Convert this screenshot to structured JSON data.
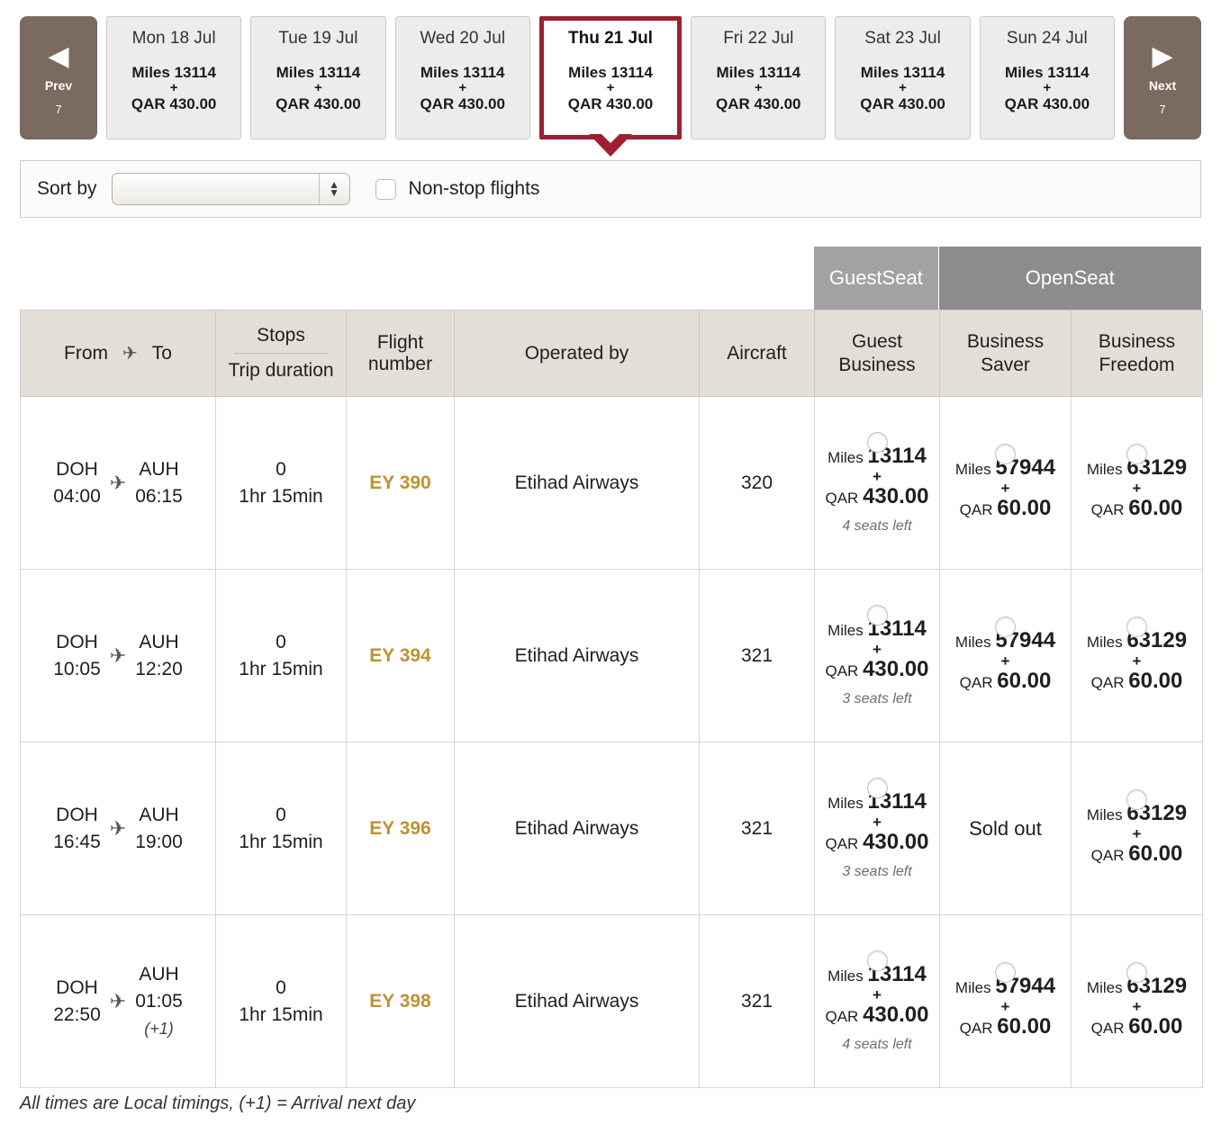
{
  "date_strip": {
    "prev": {
      "label": "Prev",
      "count": "7",
      "icon": "chevron-left-icon",
      "glyph": "◀"
    },
    "next": {
      "label": "Next",
      "count": "7",
      "icon": "chevron-right-icon",
      "glyph": "▶"
    },
    "miles_prefix": "Miles",
    "plus": "+",
    "currency": "QAR",
    "cards": [
      {
        "date": "Mon 18 Jul",
        "miles": "13114",
        "amount": "430.00",
        "selected": false
      },
      {
        "date": "Tue 19 Jul",
        "miles": "13114",
        "amount": "430.00",
        "selected": false
      },
      {
        "date": "Wed 20 Jul",
        "miles": "13114",
        "amount": "430.00",
        "selected": false
      },
      {
        "date": "Thu 21 Jul",
        "miles": "13114",
        "amount": "430.00",
        "selected": true
      },
      {
        "date": "Fri 22 Jul",
        "miles": "13114",
        "amount": "430.00",
        "selected": false
      },
      {
        "date": "Sat 23 Jul",
        "miles": "13114",
        "amount": "430.00",
        "selected": false
      },
      {
        "date": "Sun 24 Jul",
        "miles": "13114",
        "amount": "430.00",
        "selected": false
      }
    ]
  },
  "sort_bar": {
    "sort_label": "Sort by",
    "sort_value": "",
    "spinner_up": "▲",
    "spinner_down": "▼",
    "nonstop_label": "Non-stop flights",
    "nonstop_checked": false
  },
  "table": {
    "group_headers": [
      {
        "label": "GuestSeat",
        "span": 1
      },
      {
        "label": "OpenSeat",
        "span": 2
      }
    ],
    "columns": {
      "from": "From",
      "to": "To",
      "plane_icon": "airplane-icon",
      "stops": "Stops",
      "trip_duration": "Trip duration",
      "flight_number": "Flight number",
      "operated_by": "Operated by",
      "aircraft": "Aircraft"
    },
    "fare_columns": [
      {
        "label": "Guest Business",
        "line1": "Guest",
        "line2": "Business"
      },
      {
        "label": "Business Saver",
        "line1": "Business",
        "line2": "Saver"
      },
      {
        "label": "Business Freedom",
        "line1": "Business",
        "line2": "Freedom"
      }
    ],
    "miles_prefix": "Miles",
    "plus": "+",
    "currency": "QAR",
    "sold_out_text": "Sold out",
    "rows": [
      {
        "from_code": "DOH",
        "from_time": "04:00",
        "to_code": "AUH",
        "to_time": "06:15",
        "to_nextday": "",
        "stops": "0",
        "duration": "1hr 15min",
        "flight_number": "EY 390",
        "operated_by": "Etihad Airways",
        "aircraft": "320",
        "fares": [
          {
            "available": true,
            "miles": "13114",
            "amount": "430.00",
            "seats_left": "4 seats left"
          },
          {
            "available": true,
            "miles": "57944",
            "amount": "60.00",
            "seats_left": ""
          },
          {
            "available": true,
            "miles": "63129",
            "amount": "60.00",
            "seats_left": ""
          }
        ]
      },
      {
        "from_code": "DOH",
        "from_time": "10:05",
        "to_code": "AUH",
        "to_time": "12:20",
        "to_nextday": "",
        "stops": "0",
        "duration": "1hr 15min",
        "flight_number": "EY 394",
        "operated_by": "Etihad Airways",
        "aircraft": "321",
        "fares": [
          {
            "available": true,
            "miles": "13114",
            "amount": "430.00",
            "seats_left": "3 seats left"
          },
          {
            "available": true,
            "miles": "57944",
            "amount": "60.00",
            "seats_left": ""
          },
          {
            "available": true,
            "miles": "63129",
            "amount": "60.00",
            "seats_left": ""
          }
        ]
      },
      {
        "from_code": "DOH",
        "from_time": "16:45",
        "to_code": "AUH",
        "to_time": "19:00",
        "to_nextday": "",
        "stops": "0",
        "duration": "1hr 15min",
        "flight_number": "EY 396",
        "operated_by": "Etihad Airways",
        "aircraft": "321",
        "fares": [
          {
            "available": true,
            "miles": "13114",
            "amount": "430.00",
            "seats_left": "3 seats left"
          },
          {
            "available": false,
            "miles": "",
            "amount": "",
            "seats_left": ""
          },
          {
            "available": true,
            "miles": "63129",
            "amount": "60.00",
            "seats_left": ""
          }
        ]
      },
      {
        "from_code": "DOH",
        "from_time": "22:50",
        "to_code": "AUH",
        "to_time": "01:05",
        "to_nextday": "(+1)",
        "stops": "0",
        "duration": "1hr 15min",
        "flight_number": "EY 398",
        "operated_by": "Etihad Airways",
        "aircraft": "321",
        "fares": [
          {
            "available": true,
            "miles": "13114",
            "amount": "430.00",
            "seats_left": "4 seats left"
          },
          {
            "available": true,
            "miles": "57944",
            "amount": "60.00",
            "seats_left": ""
          },
          {
            "available": true,
            "miles": "63129",
            "amount": "60.00",
            "seats_left": ""
          }
        ]
      }
    ]
  },
  "footnote": "All times are Local timings, (+1) = Arrival next day",
  "colors": {
    "selected_border": "#9c2030",
    "nav_button": "#7a6a5f",
    "flight_number": "#bf9230",
    "header_bg": "#e3ded6",
    "guestseat_group": "#a2a2a2",
    "openseat_group": "#8c8c8c",
    "guest_business_bg": "#e5e5e2",
    "business_saver_bg": "#bcbcbc",
    "business_freedom_bg": "#acb2ac"
  }
}
